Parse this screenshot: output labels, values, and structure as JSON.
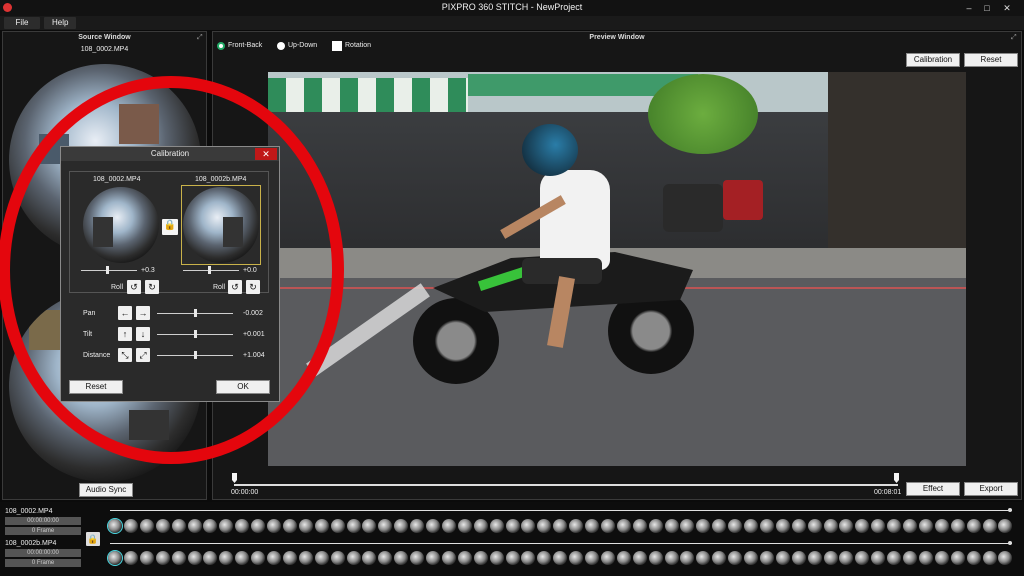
{
  "window": {
    "title": "PIXPRO 360 STITCH - NewProject",
    "min": "–",
    "max": "□",
    "close": "✕"
  },
  "menu": {
    "file": "File",
    "help": "Help"
  },
  "source": {
    "title": "Source Window",
    "filename": "108_0002.MP4",
    "audio_sync": "Audio Sync"
  },
  "preview": {
    "title": "Preview Window",
    "options": [
      {
        "label": "Front-Back",
        "selected": true
      },
      {
        "label": "Up-Down",
        "selected": false
      },
      {
        "label": "Rotation",
        "checked": false
      }
    ],
    "calibration_btn": "Calibration",
    "reset_btn": "Reset",
    "time_start": "00:00:00",
    "time_end": "00:08:01",
    "effect_btn": "Effect",
    "export_btn": "Export"
  },
  "calibration": {
    "title": "Calibration",
    "close": "✕",
    "left_file": "108_0002.MP4",
    "right_file": "108_0002b.MP4",
    "left_value": "+0.3",
    "right_value": "+0.0",
    "roll": "Roll",
    "pan": {
      "label": "Pan",
      "value": "-0.002"
    },
    "tilt": {
      "label": "Tilt",
      "value": "+0.001"
    },
    "distance": {
      "label": "Distance",
      "value": "+1.004"
    },
    "reset": "Reset",
    "ok": "OK",
    "lock_icon": "lock-icon"
  },
  "tracks": [
    {
      "name": "108_0002.MP4",
      "time": "00:00:00:00",
      "frame": "0 Frame"
    },
    {
      "name": "108_0002b.MP4",
      "time": "00:00:00:00",
      "frame": "0 Frame"
    }
  ],
  "colors": {
    "accent_red": "#e4060d",
    "close_red": "#c01818",
    "highlight": "#4ad6e0"
  }
}
